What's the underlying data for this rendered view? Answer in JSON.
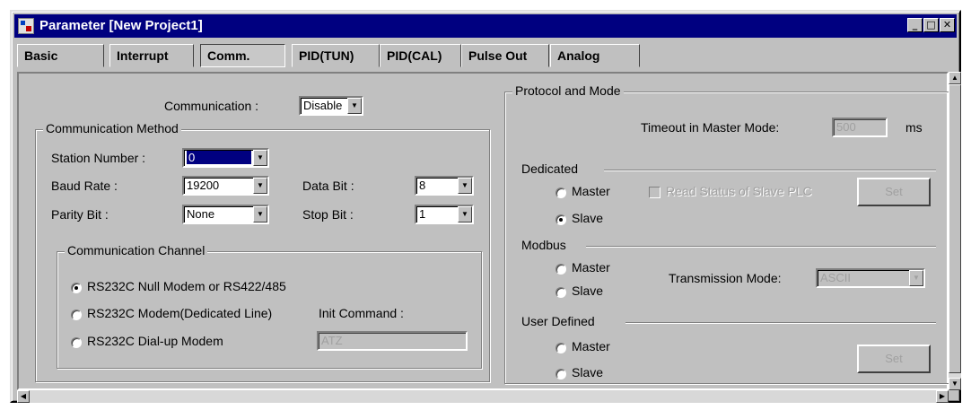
{
  "window": {
    "title": "Parameter [New Project1]",
    "buttons": {
      "minimize": "_",
      "maximize": "□",
      "close": "✕"
    }
  },
  "tabs": [
    "Basic",
    "Interrupt",
    "Comm.",
    "PID(TUN)",
    "PID(CAL)",
    "Pulse Out",
    "Analog"
  ],
  "active_tab": "Comm.",
  "communication": {
    "label": "Communication :",
    "value": "Disable"
  },
  "method": {
    "title": "Communication Method",
    "station_label": "Station Number :",
    "station_value": "0",
    "baud_label": "Baud Rate :",
    "baud_value": "19200",
    "data_label": "Data Bit :",
    "data_value": "8",
    "parity_label": "Parity Bit :",
    "parity_value": "None",
    "stop_label": "Stop Bit :",
    "stop_value": "1"
  },
  "channel": {
    "title": "Communication Channel",
    "options": [
      "RS232C Null Modem or RS422/485",
      "RS232C Modem(Dedicated Line)",
      "RS232C Dial-up Modem"
    ],
    "selected_index": 0,
    "init_label": "Init Command :",
    "init_value": "ATZ"
  },
  "protocol": {
    "title": "Protocol and Mode",
    "timeout_label": "Timeout in Master Mode:",
    "timeout_value": "500",
    "timeout_unit": "ms",
    "dedicated": {
      "title": "Dedicated",
      "master": "Master",
      "slave": "Slave",
      "selected": "slave",
      "read_status_label": "Read Status of Slave PLC",
      "set_button": "Set"
    },
    "modbus": {
      "title": "Modbus",
      "master": "Master",
      "slave": "Slave",
      "transmission_label": "Transmission Mode:",
      "transmission_value": "ASCII"
    },
    "user_defined": {
      "title": "User Defined",
      "master": "Master",
      "slave": "Slave",
      "set_button": "Set"
    }
  },
  "colors": {
    "titlebar": "#000080",
    "face": "#c0c0c0",
    "disabled_text": "#a0a0a0"
  }
}
